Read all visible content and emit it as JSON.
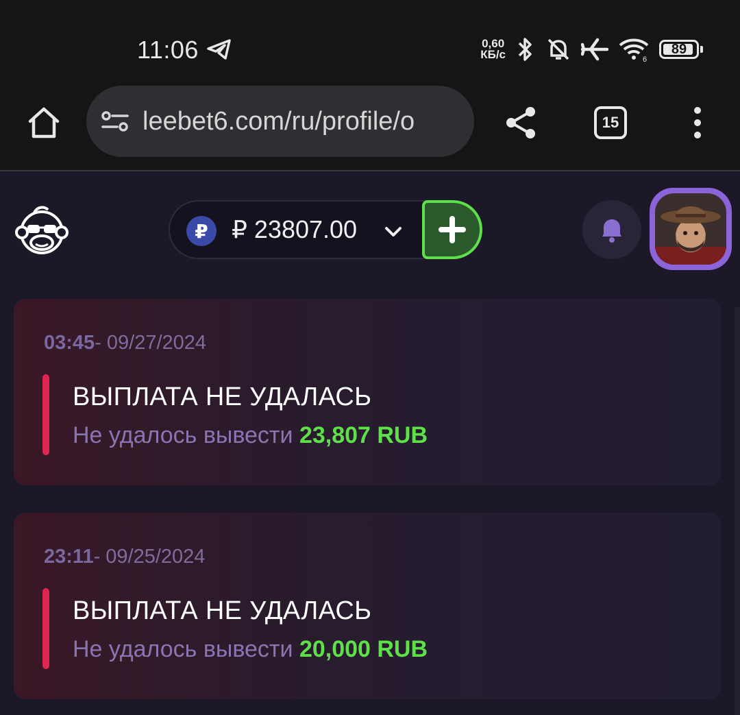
{
  "status_bar": {
    "time": "11:06",
    "net_speed_value": "0,60",
    "net_speed_unit": "КБ/с",
    "battery": "89",
    "icons": [
      "telegram-icon",
      "bluetooth-icon",
      "bell-muted-icon",
      "airplane-icon",
      "wifi-icon",
      "battery-icon"
    ]
  },
  "browser": {
    "url": "leebet6.com/ru/profile/o",
    "tab_count": "15"
  },
  "header": {
    "currency_symbol": "₽",
    "balance": "₽ 23807.00",
    "colors": {
      "deposit_border": "#5ee04a",
      "avatar_ring": "#8b64d9"
    }
  },
  "notifications": [
    {
      "time": "03:45",
      "date": "- 09/27/2024",
      "title": "ВЫПЛАТА НЕ УДАЛАСЬ",
      "message": "Не удалось вывести",
      "amount": "23,807 RUB"
    },
    {
      "time": "23:11",
      "date": "- 09/25/2024",
      "title": "ВЫПЛАТА НЕ УДАЛАСЬ",
      "message": "Не удалось вывести",
      "amount": "20,000 RUB"
    }
  ],
  "colors": {
    "page_bg": "#1c1828",
    "error_accent": "#e0254f",
    "amount_green": "#5ee04a",
    "muted_purple": "#8a74b2"
  }
}
